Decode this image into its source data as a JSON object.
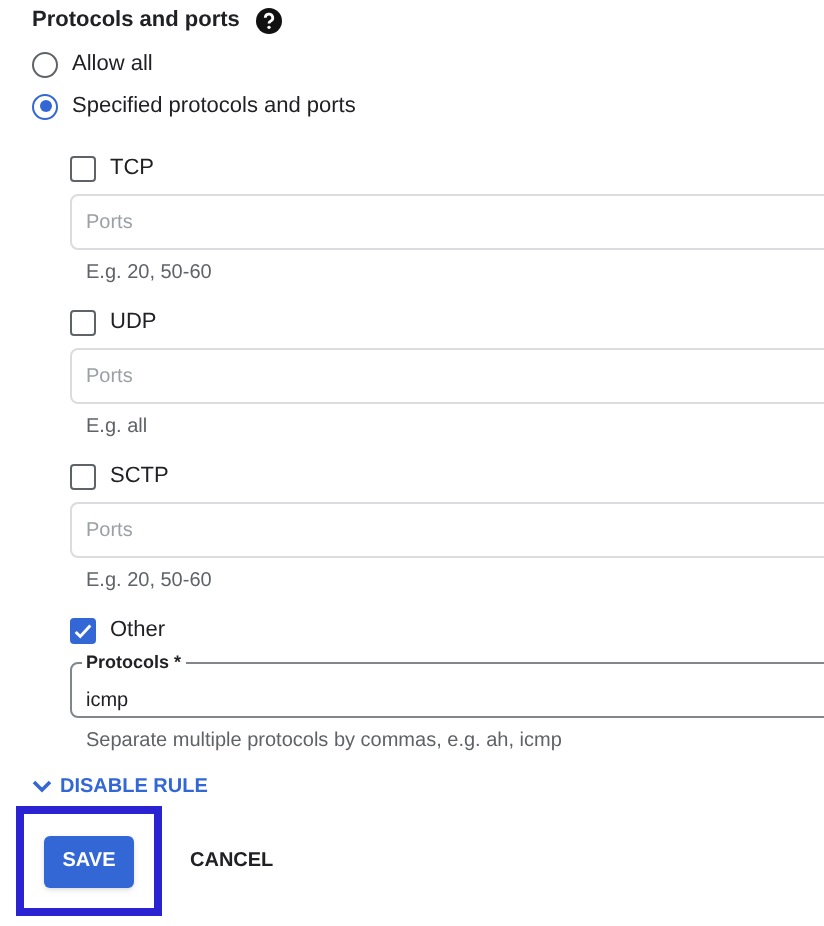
{
  "title": "Protocols and ports",
  "radios": [
    {
      "label": "Allow all",
      "selected": false
    },
    {
      "label": "Specified protocols and ports",
      "selected": true
    }
  ],
  "protocols": [
    {
      "kind": "ports",
      "label": "TCP",
      "checked": false,
      "placeholder": "Ports",
      "hint": "E.g. 20, 50-60"
    },
    {
      "kind": "ports",
      "label": "UDP",
      "checked": false,
      "placeholder": "Ports",
      "hint": "E.g. all"
    },
    {
      "kind": "ports",
      "label": "SCTP",
      "checked": false,
      "placeholder": "Ports",
      "hint": "E.g. 20, 50-60"
    },
    {
      "kind": "other",
      "label": "Other",
      "checked": true,
      "field_label": "Protocols *",
      "value": "icmp",
      "hint": "Separate multiple protocols by commas, e.g. ah, icmp"
    }
  ],
  "disable_rule": {
    "label": "DISABLE RULE"
  },
  "buttons": [
    {
      "kind": "primary",
      "label": "SAVE",
      "highlighted": true
    },
    {
      "kind": "text",
      "label": "CANCEL",
      "highlighted": false
    }
  ]
}
